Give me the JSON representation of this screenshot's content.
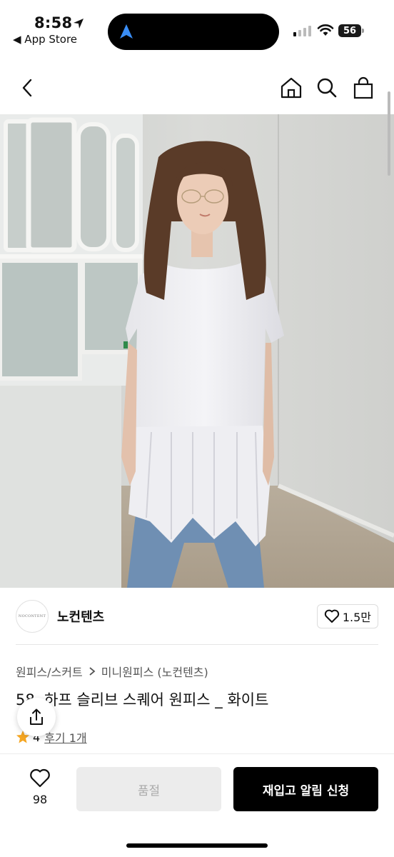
{
  "status_bar": {
    "time": "8:58",
    "back_app": "◀ App Store",
    "battery": "56"
  },
  "nav": {
    "back_icon": "chevron-left-icon",
    "home_icon": "home-icon",
    "search_icon": "search-icon",
    "cart_icon": "shopping-bag-icon"
  },
  "brand": {
    "logo_text": "NOCONTENT",
    "name": "노컨텐츠",
    "like_count": "1.5만"
  },
  "breadcrumb": {
    "category": "원피스/스커트",
    "subcategory": "미니원피스 (노컨텐츠)"
  },
  "product": {
    "title": "58. 하프 슬리브 스퀘어 원피스 _ 화이트",
    "rating": "4",
    "review_label": "후기 1개"
  },
  "bottom": {
    "wish_count": "98",
    "soldout_label": "품절",
    "restock_label": "재입고 알림 신청"
  },
  "colors": {
    "accent": "#000000",
    "star": "#f5a623",
    "soldout_bg": "#ececec"
  }
}
